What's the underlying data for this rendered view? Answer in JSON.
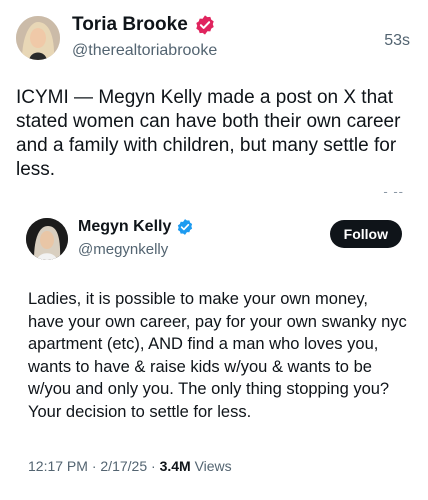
{
  "post": {
    "author_name": "Toria Brooke",
    "author_handle": "@therealtoriabrooke",
    "timestamp": "53s",
    "text": "ICYMI — Megyn Kelly made a post on X that stated women can have both their own career and a family with children, but many settle for less.",
    "separator": "- --",
    "verified_color": "#e0245e"
  },
  "embed": {
    "author_name": "Megyn Kelly",
    "author_handle": "@megynkelly",
    "follow_label": "Follow",
    "text": "Ladies, it is possible to make your own money, have your own career, pay for your own swanky nyc apartment (etc), AND find a man who loves you, wants to have & raise kids w/you & wants to be w/you and only you. The only thing stopping you? Your decision to settle for less.",
    "time": "12:17 PM",
    "date": "2/17/25",
    "dot": "·",
    "views_count": "3.4M",
    "views_label": "Views",
    "verified_color": "#1d9bf0"
  }
}
